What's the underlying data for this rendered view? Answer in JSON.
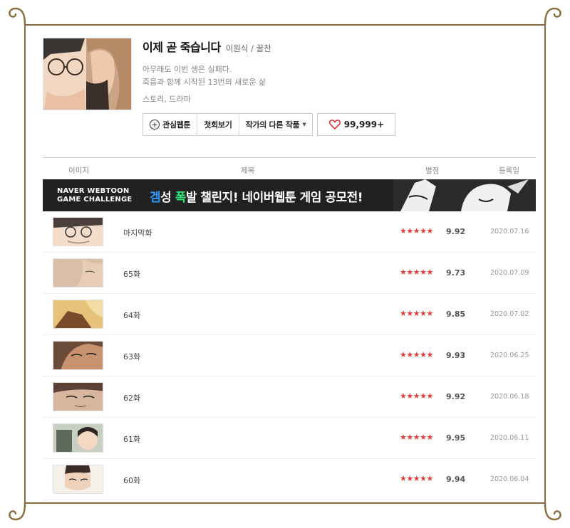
{
  "webtoon": {
    "title": "이제 곧 죽습니다",
    "author": "이원식 / 꿀찬",
    "description_line1": "아무래도 이번 생은 실패다.",
    "description_line2": "죽음과 함께 시작된 13번의 새로운 삶",
    "genre": "스토리, 드라마"
  },
  "buttons": {
    "favorite": "관심웹툰",
    "first_episode": "첫회보기",
    "other_works": "작가의 다른 작품",
    "likes": "99,999+"
  },
  "list_header": {
    "image": "이미지",
    "title": "제목",
    "rating": "별점",
    "date": "등록일"
  },
  "banner": {
    "left_line1": "NAVER WEBTOON",
    "left_line2": "GAME CHALLENGE",
    "part1": "겜",
    "part2": "성 ",
    "part3": "폭",
    "part4": "발 챌린지! 네이버웹툰 게임 공모전!"
  },
  "episodes": [
    {
      "title": "마지막화",
      "stars": "★★★★★",
      "rating": "9.92",
      "date": "2020.07.16"
    },
    {
      "title": "65화",
      "stars": "★★★★★",
      "rating": "9.73",
      "date": "2020.07.09"
    },
    {
      "title": "64화",
      "stars": "★★★★★",
      "rating": "9.85",
      "date": "2020.07.02"
    },
    {
      "title": "63화",
      "stars": "★★★★★",
      "rating": "9.93",
      "date": "2020.06.25"
    },
    {
      "title": "62화",
      "stars": "★★★★★",
      "rating": "9.92",
      "date": "2020.06.18"
    },
    {
      "title": "61화",
      "stars": "★★★★★",
      "rating": "9.95",
      "date": "2020.06.11"
    },
    {
      "title": "60화",
      "stars": "★★★★★",
      "rating": "9.94",
      "date": "2020.06.04"
    }
  ],
  "colors": {
    "frame": "#8a6c3e",
    "star": "#e73b3b",
    "heart": "#e4343a",
    "banner_blue": "#2e9bff",
    "banner_green": "#31e87a"
  }
}
